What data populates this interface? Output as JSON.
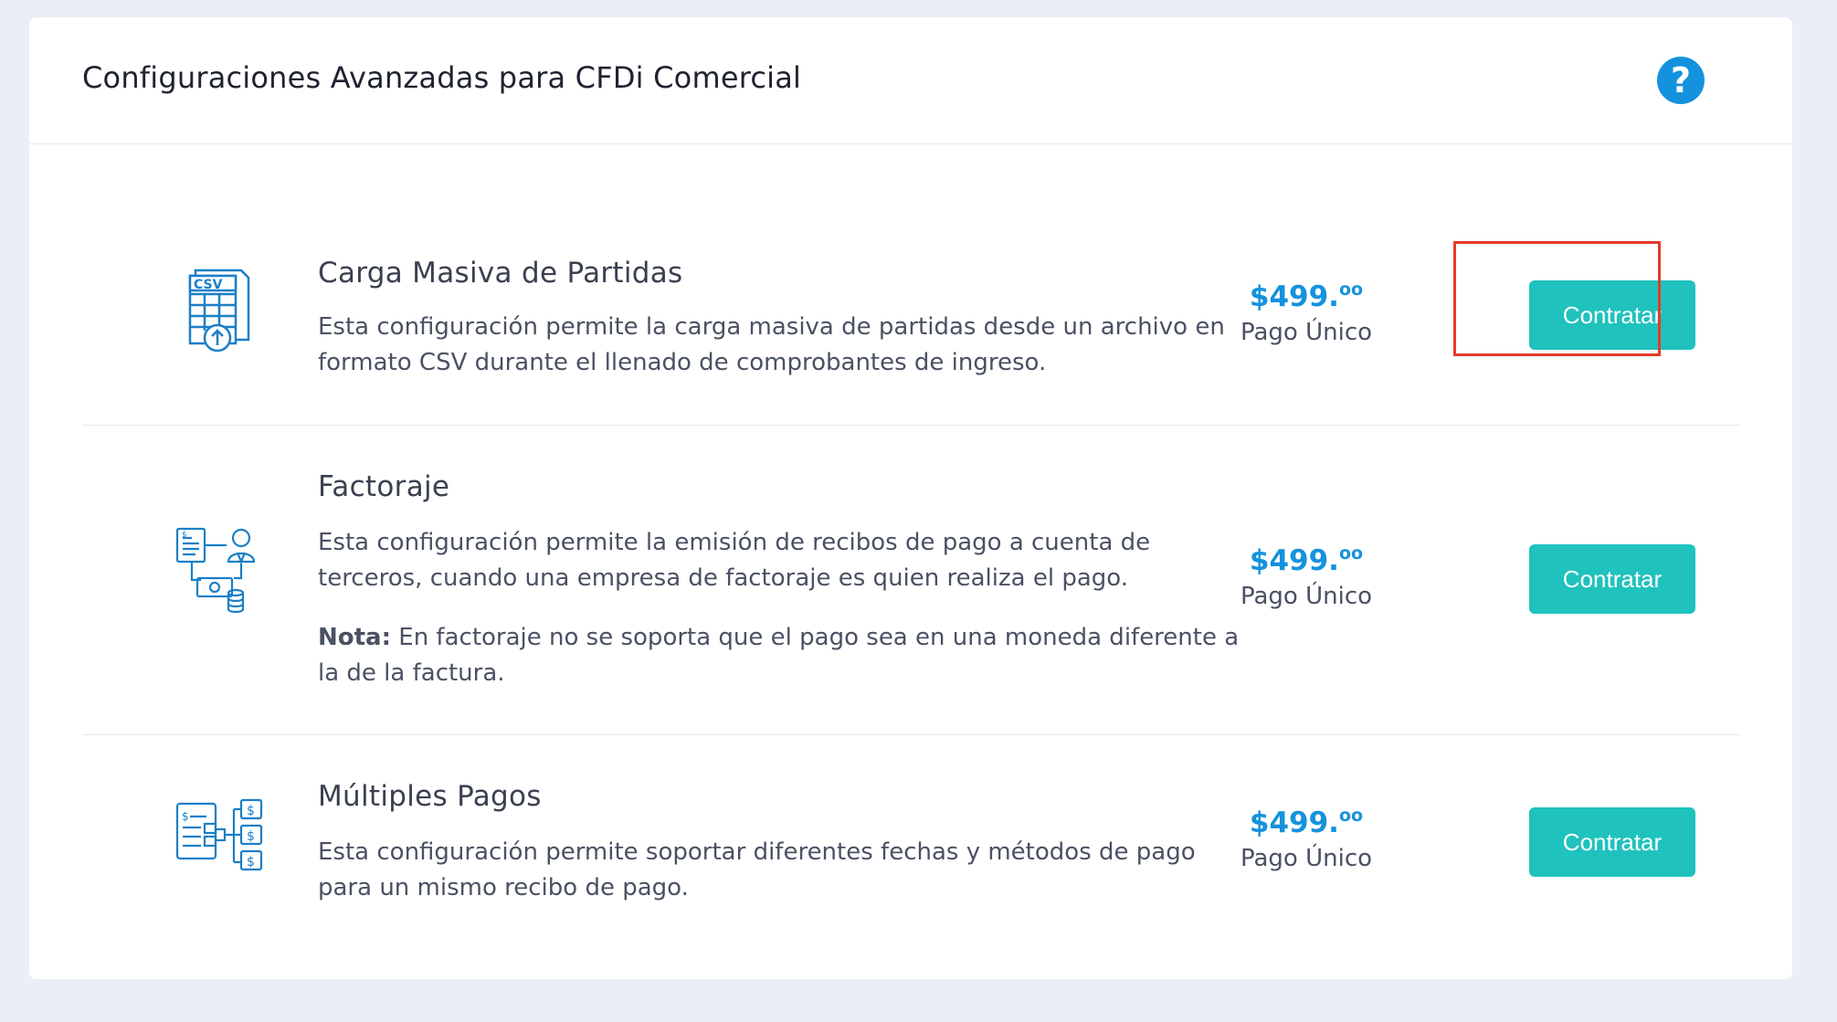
{
  "header": {
    "title": "Configuraciones Avanzadas para CFDi Comercial",
    "help_icon": "question-circle-icon"
  },
  "colors": {
    "accent": "#1592dd",
    "button": "#1fc2bd",
    "highlight": "#e53a2c",
    "background": "#ebeef6"
  },
  "items": [
    {
      "title": "Carga Masiva de Partidas",
      "description": "Esta configuración permite la carga masiva de partidas desde un archivo en formato CSV durante el llenado de comprobantes de ingreso.",
      "price_main": "$499.",
      "price_cents": "oo",
      "price_label": "Pago Único",
      "button_label": "Contratar",
      "icon": "csv-upload-icon"
    },
    {
      "title": "Factoraje",
      "description": "Esta configuración permite la emisión de recibos de pago a cuenta de terceros, cuando una empresa de factoraje es quien realiza el pago.",
      "note_label": "Nota:",
      "note_text": " En factoraje no se soporta que el pago sea en una moneda diferente a la de la factura.",
      "price_main": "$499.",
      "price_cents": "oo",
      "price_label": "Pago Único",
      "button_label": "Contratar",
      "icon": "factoring-icon"
    },
    {
      "title": "Múltiples Pagos",
      "description": "Esta configuración permite soportar diferentes fechas y métodos de pago para un mismo recibo de pago.",
      "price_main": "$499.",
      "price_cents": "oo",
      "price_label": "Pago Único",
      "button_label": "Contratar",
      "icon": "multiple-payments-icon"
    }
  ]
}
